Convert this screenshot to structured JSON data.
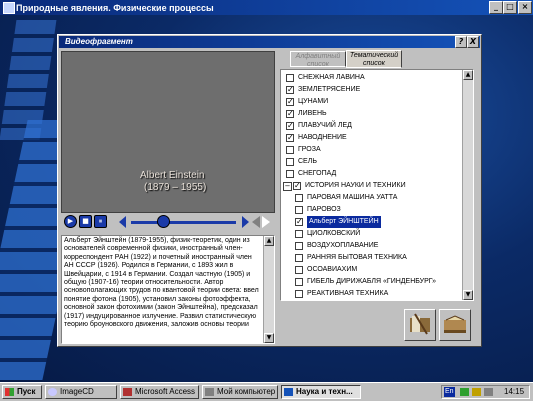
{
  "app": {
    "title": "Природные явления. Физические процессы"
  },
  "window_controls": {
    "minimize": "_",
    "maximize": "□",
    "close": "×"
  },
  "panel": {
    "title": "Видеофрагмент",
    "help": "?",
    "close": "X"
  },
  "video": {
    "caption_name": "Albert Einstein",
    "caption_years": "(1879 – 1955)"
  },
  "player": {
    "play": "▶",
    "stop": "■",
    "pause": "⏸",
    "progress": 0.3
  },
  "description": "Альберт Эйнштейн (1879-1955), физик-теоретик, один из основателей современной физики, иностранный член-корреспондент РАН (1922) и почетный иностранный член АН СССР (1926). Родился в Германии, с 1893 жил в Швейцарии, с 1914 в Германии. Создал частную (1905) и общую (1907-16) теории относительности. Автор основополагающих трудов по квантовой теории света: ввел понятие фотона (1905), установил законы фотоэффекта, основной закон фотохимии (закон Эйнштейна), предсказал (1917) индуцированное излучение. Развил статистическую теорию броуновского движения, заложив основы теории",
  "tabs": [
    {
      "label": "Алфавитный список",
      "active": false
    },
    {
      "label": "Тематический список",
      "active": true
    }
  ],
  "topics": [
    {
      "label": "СНЕЖНАЯ ЛАВИНА",
      "checked": false,
      "level": 1
    },
    {
      "label": "ЗЕМЛЕТРЯСЕНИЕ",
      "checked": true,
      "level": 1
    },
    {
      "label": "ЦУНАМИ",
      "checked": true,
      "level": 1
    },
    {
      "label": "ЛИВЕНЬ",
      "checked": true,
      "level": 1
    },
    {
      "label": "ПЛАВУЧИЙ ЛЕД",
      "checked": true,
      "level": 1
    },
    {
      "label": "НАВОДНЕНИЕ",
      "checked": true,
      "level": 1
    },
    {
      "label": "ГРОЗА",
      "checked": false,
      "level": 1
    },
    {
      "label": "СЕЛЬ",
      "checked": false,
      "level": 1
    },
    {
      "label": "СНЕГОПАД",
      "checked": false,
      "level": 1
    },
    {
      "label": "ИСТОРИЯ НАУКИ И ТЕХНИКИ",
      "checked": true,
      "level": 0,
      "expander": "−"
    },
    {
      "label": "ПАРОВАЯ МАШИНА УАТТА",
      "checked": false,
      "level": 2
    },
    {
      "label": "ПАРОВОЗ",
      "checked": false,
      "level": 2
    },
    {
      "label": "Альберт ЭЙНШТЕЙН",
      "checked": true,
      "level": 2,
      "selected": true
    },
    {
      "label": "ЦИОЛКОВСКИЙ",
      "checked": false,
      "level": 2
    },
    {
      "label": "ВОЗДУХОПЛАВАНИЕ",
      "checked": false,
      "level": 2
    },
    {
      "label": "РАННЯЯ БЫТОВАЯ ТЕХНИКА",
      "checked": false,
      "level": 2
    },
    {
      "label": "ОСОАВИАХИМ",
      "checked": false,
      "level": 2
    },
    {
      "label": "ГИБЕЛЬ ДИРИЖАБЛЯ «ГИНДЕНБУРГ»",
      "checked": false,
      "level": 2
    },
    {
      "label": "РЕАКТИВНАЯ ТЕХНИКА",
      "checked": false,
      "level": 2
    }
  ],
  "taskbar": {
    "start": "Пуск",
    "items": [
      {
        "label": "ImageCD",
        "pressed": false
      },
      {
        "label": "Microsoft Access",
        "pressed": false
      },
      {
        "label": "Мой компьютер",
        "pressed": false
      },
      {
        "label": "Наука и техн...",
        "pressed": true
      }
    ],
    "tray_lang": "En",
    "clock": "14:15"
  },
  "colors": {
    "title_bar": "#0a2a7a",
    "selection": "#0a2a9e",
    "player_blue": "#1a3aa8"
  }
}
